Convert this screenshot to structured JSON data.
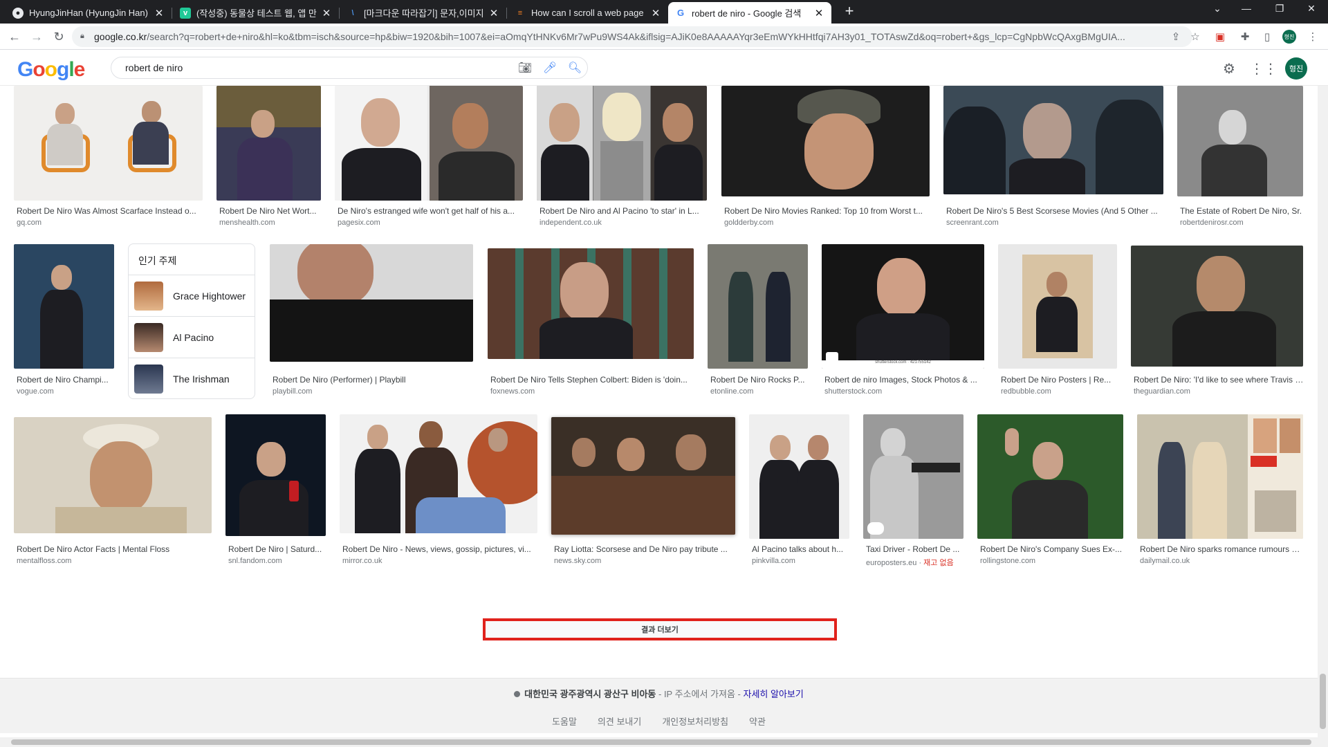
{
  "browser": {
    "tabs": [
      {
        "title": "HyungJinHan (HyungJin Han)",
        "favicon": "github-icon",
        "active": false
      },
      {
        "title": "(작성중) 동물상 테스트 웹, 앱 만",
        "favicon": "velog-icon",
        "active": false
      },
      {
        "title": "[마크다운 따라잡기] 문자,이미지",
        "favicon": "blog-icon",
        "active": false
      },
      {
        "title": "How can I scroll a web page us",
        "favicon": "stackoverflow-icon",
        "active": false
      },
      {
        "title": "robert de niro - Google 검색",
        "favicon": "google-icon",
        "active": true
      }
    ],
    "url_host": "google.co.kr",
    "url_path": "/search?q=robert+de+niro&hl=ko&tbm=isch&source=hp&biw=1920&bih=1007&ei=aOmqYtHNKv6Mr7wPu9WS4Ak&iflsig=AJiK0e8AAAAAYqr3eEmWYkHHtfqi7AH3y01_TOTAswZd&oq=robert+&gs_lcp=CgNpbWcQAxgBMgUIA..."
  },
  "search": {
    "query": "robert de niro",
    "avatar_label": "형진"
  },
  "results": {
    "row1": [
      {
        "caption": "Robert De Niro Was Almost Scarface Instead o...",
        "source": "gq.com"
      },
      {
        "caption": "Robert De Niro Net Wort...",
        "source": "menshealth.com"
      },
      {
        "caption": "De Niro's estranged wife won't get half of his a...",
        "source": "pagesix.com"
      },
      {
        "caption": "Robert De Niro and Al Pacino 'to star' in L...",
        "source": "independent.co.uk"
      },
      {
        "caption": "Robert De Niro Movies Ranked: Top 10 from Worst t...",
        "source": "goldderby.com"
      },
      {
        "caption": "Robert De Niro's 5 Best Scorsese Movies (And 5 Other ...",
        "source": "screenrant.com"
      },
      {
        "caption": "The Estate of Robert De Niro, Sr.",
        "source": "robertdenirosr.com"
      }
    ],
    "row2": [
      {
        "caption": "Robert de Niro Champi...",
        "source": "vogue.com"
      },
      {
        "caption": "Robert De Niro (Performer) | Playbill",
        "source": "playbill.com"
      },
      {
        "caption": "Robert De Niro Tells Stephen Colbert: Biden is 'doin...",
        "source": "foxnews.com"
      },
      {
        "caption": "Robert De Niro Rocks P...",
        "source": "etonline.com"
      },
      {
        "caption": "Robert de niro Images, Stock Photos & ...",
        "source": "shutterstock.com",
        "overlay": "shutterstock.com · 421755142"
      },
      {
        "caption": "Robert De Niro Posters | Re...",
        "source": "redbubble.com"
      },
      {
        "caption": "Robert De Niro: 'I'd like to see where Travis Bi...",
        "source": "theguardian.com"
      }
    ],
    "row3": [
      {
        "caption": "Robert De Niro Actor Facts | Mental Floss",
        "source": "mentalfloss.com"
      },
      {
        "caption": "Robert De Niro | Saturd...",
        "source": "snl.fandom.com"
      },
      {
        "caption": "Robert De Niro - News, views, gossip, pictures, vi...",
        "source": "mirror.co.uk"
      },
      {
        "caption": "Ray Liotta: Scorsese and De Niro pay tribute ...",
        "source": "news.sky.com"
      },
      {
        "caption": "Al Pacino talks about h...",
        "source": "pinkvilla.com"
      },
      {
        "caption": "Taxi Driver - Robert De ...",
        "source": "europosters.eu",
        "stock_note": "재고 없음"
      },
      {
        "caption": "Robert De Niro's Company Sues Ex-...",
        "source": "rollingstone.com"
      },
      {
        "caption": "Robert De Niro sparks romance rumours wi...",
        "source": "dailymail.co.uk"
      }
    ]
  },
  "related": {
    "title": "인기 주제",
    "items": [
      {
        "label": "Grace Hightower"
      },
      {
        "label": "Al Pacino"
      },
      {
        "label": "The Irishman"
      }
    ]
  },
  "more_results_label": "결과 더보기",
  "footer": {
    "location": "대한민국 광주광역시 광산구 비아동",
    "ip_text": " - IP 주소에서 가져옴 - ",
    "learn_more": "자세히 알아보기",
    "links": [
      "도움말",
      "의견 보내기",
      "개인정보처리방침",
      "약관"
    ]
  },
  "colors": {
    "highlight_border": "#e0221c",
    "google_blue": "#4285f4",
    "google_red": "#ea4335",
    "google_yellow": "#fbbc05",
    "google_green": "#34a853"
  }
}
